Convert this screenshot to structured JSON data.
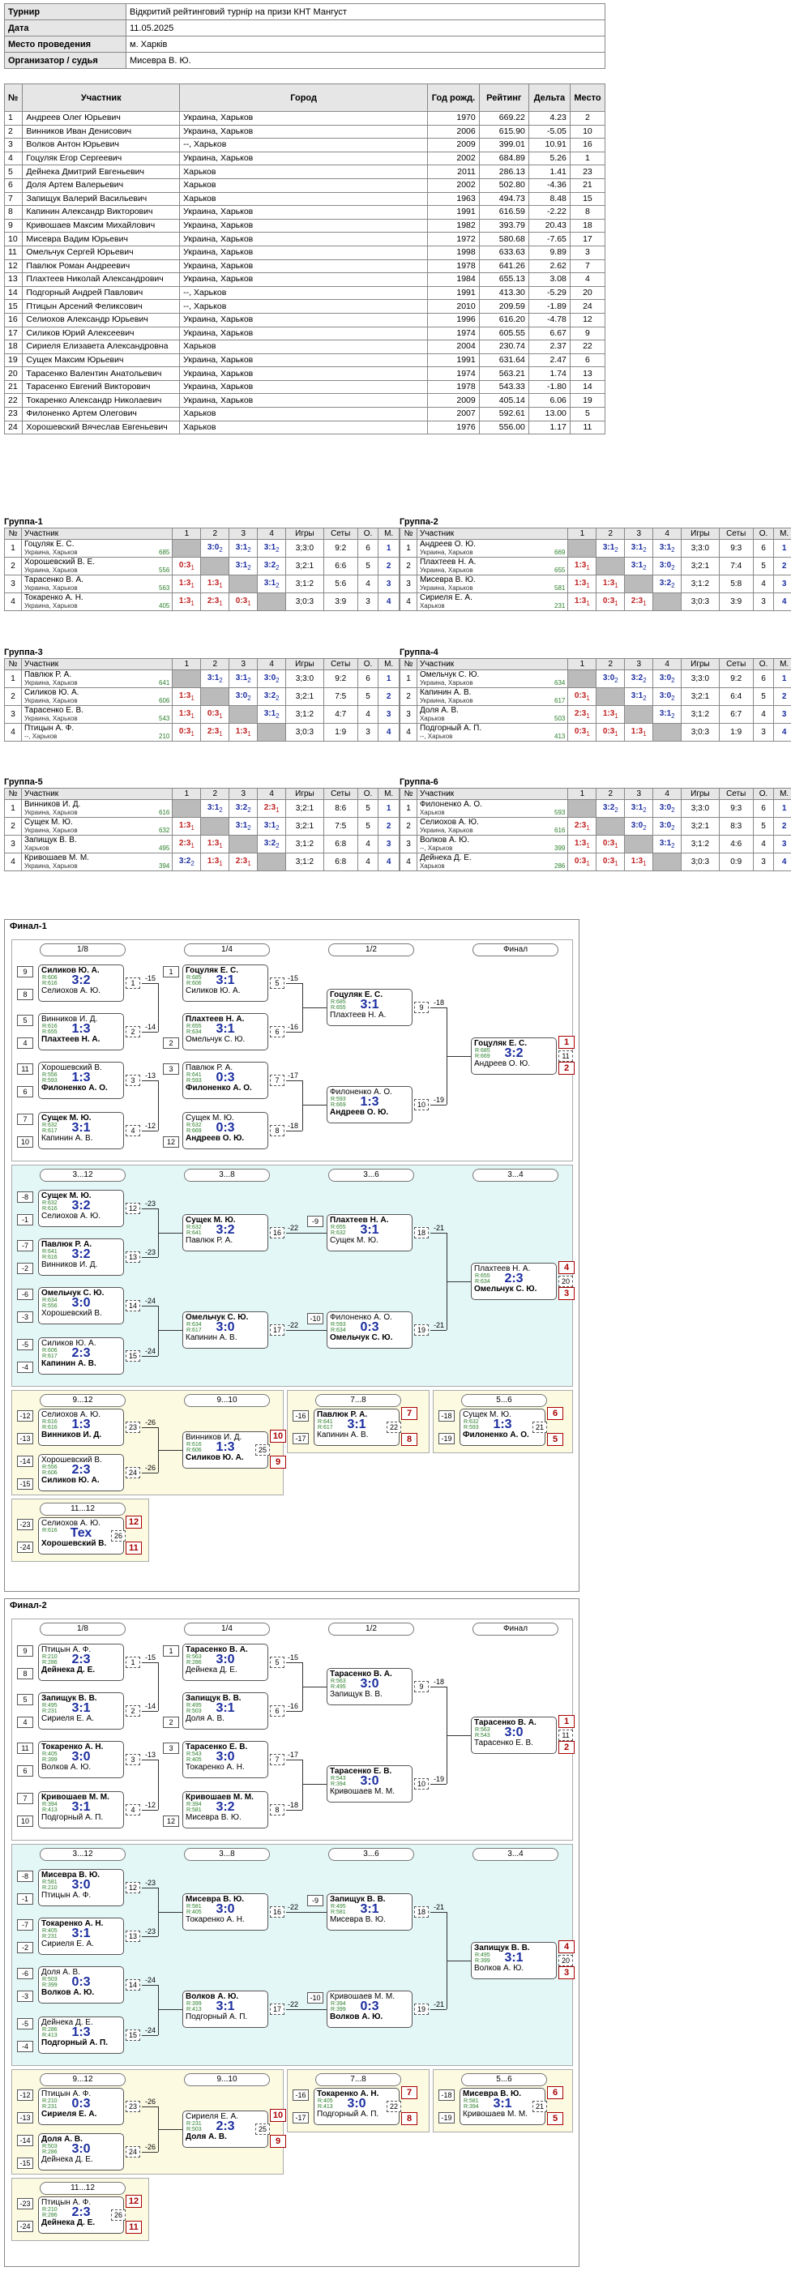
{
  "info": [
    {
      "k": "Турнир",
      "v": "Відкритий рейтинговий турнір на призи КНТ Мангуст"
    },
    {
      "k": "Дата",
      "v": "11.05.2025"
    },
    {
      "k": "Место проведения",
      "v": "м. Харків"
    },
    {
      "k": "Организатор / судья",
      "v": "Мисевра В. Ю."
    }
  ],
  "players_header": [
    "№",
    "Участник",
    "Город",
    "Год рожд.",
    "Рейтинг",
    "Дельта",
    "Место"
  ],
  "players": [
    [
      "1",
      "Андреев Олег Юрьевич",
      "Украина, Харьков",
      "1970",
      "669.22",
      "4.23",
      "2"
    ],
    [
      "2",
      "Винников Иван Денисович",
      "Украина, Харьков",
      "2006",
      "615.90",
      "-5.05",
      "10"
    ],
    [
      "3",
      "Волков Антон Юрьевич",
      "--, Харьков",
      "2009",
      "399.01",
      "10.91",
      "16"
    ],
    [
      "4",
      "Гоцуляк Егор Сергеевич",
      "Украина, Харьков",
      "2002",
      "684.89",
      "5.26",
      "1"
    ],
    [
      "5",
      "Дейнека Дмитрий Евгеньевич",
      "Харьков",
      "2011",
      "286.13",
      "1.41",
      "23"
    ],
    [
      "6",
      "Доля Артем Валерьевич",
      "Харьков",
      "2002",
      "502.80",
      "-4.36",
      "21"
    ],
    [
      "7",
      "Запищук Валерий Васильевич",
      "Харьков",
      "1963",
      "494.73",
      "8.48",
      "15"
    ],
    [
      "8",
      "Капинин Александр Викторович",
      "Украина, Харьков",
      "1991",
      "616.59",
      "-2.22",
      "8"
    ],
    [
      "9",
      "Кривошаев Максим Михайлович",
      "Украина, Харьков",
      "1982",
      "393.79",
      "20.43",
      "18"
    ],
    [
      "10",
      "Мисевра Вадим Юрьевич",
      "Украина, Харьков",
      "1972",
      "580.68",
      "-7.65",
      "17"
    ],
    [
      "11",
      "Омельчук Сергей Юрьевич",
      "Украина, Харьков",
      "1998",
      "633.63",
      "9.89",
      "3"
    ],
    [
      "12",
      "Павлюк Роман Андреевич",
      "Украина, Харьков",
      "1978",
      "641.26",
      "2.62",
      "7"
    ],
    [
      "13",
      "Плахтеев Николай Александрович",
      "Украина, Харьков",
      "1984",
      "655.13",
      "3.08",
      "4"
    ],
    [
      "14",
      "Подгорный Андрей Павлович",
      "--, Харьков",
      "1991",
      "413.30",
      "-5.29",
      "20"
    ],
    [
      "15",
      "Птицын Арсений Феликсович",
      "--, Харьков",
      "2010",
      "209.59",
      "-1.89",
      "24"
    ],
    [
      "16",
      "Селиохов Александр Юрьевич",
      "Украина, Харьков",
      "1996",
      "616.20",
      "-4.78",
      "12"
    ],
    [
      "17",
      "Силиков Юрий Алексеевич",
      "Украина, Харьков",
      "1974",
      "605.55",
      "6.67",
      "9"
    ],
    [
      "18",
      "Сириеля Елизавета Александровна",
      "Харьков",
      "2004",
      "230.74",
      "2.37",
      "22"
    ],
    [
      "19",
      "Сущек Максим Юрьевич",
      "Украина, Харьков",
      "1991",
      "631.64",
      "2.47",
      "6"
    ],
    [
      "20",
      "Тарасенко Валентин Анатольевич",
      "Украина, Харьков",
      "1974",
      "563.21",
      "1.74",
      "13"
    ],
    [
      "21",
      "Тарасенко Евгений Викторович",
      "Украина, Харьков",
      "1978",
      "543.33",
      "-1.80",
      "14"
    ],
    [
      "22",
      "Токаренко Александр Николаевич",
      "Украина, Харьков",
      "2009",
      "405.14",
      "6.06",
      "19"
    ],
    [
      "23",
      "Филоненко Артем Олегович",
      "Харьков",
      "2007",
      "592.61",
      "13.00",
      "5"
    ],
    [
      "24",
      "Хорошевский Вячеслав Евгеньевич",
      "Харьков",
      "1976",
      "556.00",
      "1.17",
      "11"
    ]
  ],
  "group_header": [
    "№",
    "Участник",
    "1",
    "2",
    "3",
    "4",
    "Игры",
    "Сеты",
    "О.",
    "М."
  ],
  "groups": [
    {
      "title": "Группа-1",
      "rows": [
        {
          "n": "1",
          "name": "Гоцуляк Е. С.",
          "city": "Украина, Харьков",
          "rt": "685",
          "res": [
            "",
            "3:0",
            "3:1",
            "3:1"
          ],
          "subs": [
            "",
            "2",
            "2",
            "2"
          ],
          "games": "3;3:0",
          "sets": "9:2",
          "o": "6",
          "m": "1"
        },
        {
          "n": "2",
          "name": "Хорошевский В. Е.",
          "city": "Украина, Харьков",
          "rt": "556",
          "res": [
            "0:3",
            "",
            "3:1",
            "3:2"
          ],
          "subs": [
            "1",
            "",
            "2",
            "2"
          ],
          "games": "3;2:1",
          "sets": "6:6",
          "o": "5",
          "m": "2"
        },
        {
          "n": "3",
          "name": "Тарасенко В. А.",
          "city": "Украина, Харьков",
          "rt": "563",
          "res": [
            "1:3",
            "1:3",
            "",
            "3:1"
          ],
          "subs": [
            "1",
            "1",
            "",
            "2"
          ],
          "games": "3;1:2",
          "sets": "5:6",
          "o": "4",
          "m": "3"
        },
        {
          "n": "4",
          "name": "Токаренко А. Н.",
          "city": "Украина, Харьков",
          "rt": "405",
          "res": [
            "1:3",
            "2:3",
            "0:3",
            ""
          ],
          "subs": [
            "1",
            "1",
            "1",
            ""
          ],
          "games": "3;0:3",
          "sets": "3:9",
          "o": "3",
          "m": "4"
        }
      ]
    },
    {
      "title": "Группа-2",
      "rows": [
        {
          "n": "1",
          "name": "Андреев О. Ю.",
          "city": "Украина, Харьков",
          "rt": "669",
          "res": [
            "",
            "3:1",
            "3:1",
            "3:1"
          ],
          "subs": [
            "",
            "2",
            "2",
            "2"
          ],
          "games": "3;3:0",
          "sets": "9:3",
          "o": "6",
          "m": "1"
        },
        {
          "n": "2",
          "name": "Плахтеев Н. А.",
          "city": "Украина, Харьков",
          "rt": "655",
          "res": [
            "1:3",
            "",
            "3:1",
            "3:0"
          ],
          "subs": [
            "1",
            "",
            "2",
            "2"
          ],
          "games": "3;2:1",
          "sets": "7:4",
          "o": "5",
          "m": "2"
        },
        {
          "n": "3",
          "name": "Мисевра В. Ю.",
          "city": "Украина, Харьков",
          "rt": "581",
          "res": [
            "1:3",
            "1:3",
            "",
            "3:2"
          ],
          "subs": [
            "1",
            "1",
            "",
            "2"
          ],
          "games": "3;1:2",
          "sets": "5:8",
          "o": "4",
          "m": "3"
        },
        {
          "n": "4",
          "name": "Сириеля Е. А.",
          "city": "Харьков",
          "rt": "231",
          "res": [
            "1:3",
            "0:3",
            "2:3",
            ""
          ],
          "subs": [
            "1",
            "1",
            "1",
            ""
          ],
          "games": "3;0:3",
          "sets": "3:9",
          "o": "3",
          "m": "4"
        }
      ]
    },
    {
      "title": "Группа-3",
      "rows": [
        {
          "n": "1",
          "name": "Павлюк Р. А.",
          "city": "Украина, Харьков",
          "rt": "641",
          "res": [
            "",
            "3:1",
            "3:1",
            "3:0"
          ],
          "subs": [
            "",
            "2",
            "2",
            "2"
          ],
          "games": "3;3:0",
          "sets": "9:2",
          "o": "6",
          "m": "1"
        },
        {
          "n": "2",
          "name": "Силиков Ю. А.",
          "city": "Украина, Харьков",
          "rt": "606",
          "res": [
            "1:3",
            "",
            "3:0",
            "3:2"
          ],
          "subs": [
            "1",
            "",
            "2",
            "2"
          ],
          "games": "3;2:1",
          "sets": "7:5",
          "o": "5",
          "m": "2"
        },
        {
          "n": "3",
          "name": "Тарасенко Е. В.",
          "city": "Украина, Харьков",
          "rt": "543",
          "res": [
            "1:3",
            "0:3",
            "",
            "3:1"
          ],
          "subs": [
            "1",
            "1",
            "",
            "2"
          ],
          "games": "3;1:2",
          "sets": "4:7",
          "o": "4",
          "m": "3"
        },
        {
          "n": "4",
          "name": "Птицын А. Ф.",
          "city": "--, Харьков",
          "rt": "210",
          "res": [
            "0:3",
            "2:3",
            "1:3",
            ""
          ],
          "subs": [
            "1",
            "1",
            "1",
            ""
          ],
          "games": "3;0:3",
          "sets": "1:9",
          "o": "3",
          "m": "4"
        }
      ]
    },
    {
      "title": "Группа-4",
      "rows": [
        {
          "n": "1",
          "name": "Омельчук С. Ю.",
          "city": "Украина, Харьков",
          "rt": "634",
          "res": [
            "",
            "3:0",
            "3:2",
            "3:0"
          ],
          "subs": [
            "",
            "2",
            "2",
            "2"
          ],
          "games": "3;3:0",
          "sets": "9:2",
          "o": "6",
          "m": "1"
        },
        {
          "n": "2",
          "name": "Капинин А. В.",
          "city": "Украина, Харьков",
          "rt": "617",
          "res": [
            "0:3",
            "",
            "3:1",
            "3:0"
          ],
          "subs": [
            "1",
            "",
            "2",
            "2"
          ],
          "games": "3;2:1",
          "sets": "6:4",
          "o": "5",
          "m": "2"
        },
        {
          "n": "3",
          "name": "Доля А. В.",
          "city": "Харьков",
          "rt": "503",
          "res": [
            "2:3",
            "1:3",
            "",
            "3:1"
          ],
          "subs": [
            "1",
            "1",
            "",
            "2"
          ],
          "games": "3;1:2",
          "sets": "6:7",
          "o": "4",
          "m": "3"
        },
        {
          "n": "4",
          "name": "Подгорный А. П.",
          "city": "--, Харьков",
          "rt": "413",
          "res": [
            "0:3",
            "0:3",
            "1:3",
            ""
          ],
          "subs": [
            "1",
            "1",
            "1",
            ""
          ],
          "games": "3;0:3",
          "sets": "1:9",
          "o": "3",
          "m": "4"
        }
      ]
    },
    {
      "title": "Группа-5",
      "rows": [
        {
          "n": "1",
          "name": "Винников И. Д.",
          "city": "Украина, Харьков",
          "rt": "616",
          "res": [
            "",
            "3:1",
            "3:2",
            "2:3"
          ],
          "subs": [
            "",
            "2",
            "2",
            "1"
          ],
          "games": "3;2:1",
          "sets": "8:6",
          "o": "5",
          "m": "1"
        },
        {
          "n": "2",
          "name": "Сущек М. Ю.",
          "city": "Украина, Харьков",
          "rt": "632",
          "res": [
            "1:3",
            "",
            "3:1",
            "3:1"
          ],
          "subs": [
            "1",
            "",
            "2",
            "2"
          ],
          "games": "3;2:1",
          "sets": "7:5",
          "o": "5",
          "m": "2"
        },
        {
          "n": "3",
          "name": "Запищук В. В.",
          "city": "Харьков",
          "rt": "495",
          "res": [
            "2:3",
            "1:3",
            "",
            "3:2"
          ],
          "subs": [
            "1",
            "1",
            "",
            "2"
          ],
          "games": "3;1:2",
          "sets": "6:8",
          "o": "4",
          "m": "3"
        },
        {
          "n": "4",
          "name": "Кривошаев М. М.",
          "city": "Украина, Харьков",
          "rt": "394",
          "res": [
            "3:2",
            "1:3",
            "2:3",
            ""
          ],
          "subs": [
            "2",
            "1",
            "1",
            ""
          ],
          "games": "3;1:2",
          "sets": "6:8",
          "o": "4",
          "m": "4"
        }
      ]
    },
    {
      "title": "Группа-6",
      "rows": [
        {
          "n": "1",
          "name": "Филоненко А. О.",
          "city": "Харьков",
          "rt": "593",
          "res": [
            "",
            "3:2",
            "3:1",
            "3:0"
          ],
          "subs": [
            "",
            "2",
            "2",
            "2"
          ],
          "games": "3;3:0",
          "sets": "9:3",
          "o": "6",
          "m": "1"
        },
        {
          "n": "2",
          "name": "Селиохов А. Ю.",
          "city": "Украина, Харьков",
          "rt": "616",
          "res": [
            "2:3",
            "",
            "3:0",
            "3:0"
          ],
          "subs": [
            "1",
            "",
            "2",
            "2"
          ],
          "games": "3;2:1",
          "sets": "8:3",
          "o": "5",
          "m": "2"
        },
        {
          "n": "3",
          "name": "Волков А. Ю.",
          "city": "--, Харьков",
          "rt": "399",
          "res": [
            "1:3",
            "0:3",
            "",
            "3:1"
          ],
          "subs": [
            "1",
            "1",
            "",
            "2"
          ],
          "games": "3;1:2",
          "sets": "4:6",
          "o": "4",
          "m": "3"
        },
        {
          "n": "4",
          "name": "Дейнека Д. Е.",
          "city": "Харьков",
          "rt": "286",
          "res": [
            "0:3",
            "0:3",
            "1:3",
            ""
          ],
          "subs": [
            "1",
            "1",
            "1",
            ""
          ],
          "games": "3;0:3",
          "sets": "0:9",
          "o": "3",
          "m": "4"
        }
      ]
    }
  ],
  "finals": [
    {
      "title": "Финал-1",
      "rounds_main": [
        "1/8",
        "1/4",
        "1/2",
        "Финал"
      ],
      "rounds_cons": [
        "3...12",
        "3...8",
        "3...6",
        "3...4"
      ],
      "rounds_low": [
        "9...12",
        "9...10",
        "7...8",
        "5...6",
        "11...12"
      ],
      "matches": [
        {
          "id": "a1",
          "w": "Силиков Ю. А.",
          "r1": "R:606",
          "r2": "R:616",
          "sc": "3:2",
          "l": "Селиохов А. Ю.",
          "n": "1"
        },
        {
          "id": "a2",
          "w": "Плахтеев Н. А.",
          "r1": "R:616",
          "r2": "R:655",
          "sc": "1:3",
          "l": "Винников И. Д.",
          "n": "2",
          "top": "Винников И. Д.",
          "bot": "Плахтеев Н. А."
        },
        {
          "id": "a3",
          "w": "Филоненко А. О.",
          "r1": "R:556",
          "r2": "R:593",
          "sc": "1:3",
          "l": "Хорошевский В. Е.",
          "n": "3",
          "top": "Хорошевский В. Е.",
          "bot": "Филоненко А. О."
        },
        {
          "id": "a4",
          "w": "Сущек М. Ю.",
          "r1": "R:632",
          "r2": "R:617",
          "sc": "3:1",
          "l": "Капинин А. В.",
          "n": "4"
        },
        {
          "id": "b1",
          "w": "Гоцуляк Е. С.",
          "r1": "R:685",
          "r2": "R:606",
          "sc": "3:1",
          "l": "Силиков Ю. А.",
          "n": "5"
        },
        {
          "id": "b2",
          "w": "Плахтеев Н. А.",
          "r1": "R:655",
          "r2": "R:634",
          "sc": "3:1",
          "l": "Омельчук С. Ю.",
          "n": "6"
        },
        {
          "id": "b3",
          "w": "Филоненко А. О.",
          "r1": "R:641",
          "r2": "R:593",
          "sc": "0:3",
          "l": "Павлюк Р. А.",
          "n": "7",
          "top": "Павлюк Р. А.",
          "bot": "Филоненко А. О."
        },
        {
          "id": "b4",
          "w": "Андреев О. Ю.",
          "r1": "R:632",
          "r2": "R:669",
          "sc": "0:3",
          "l": "Сущек М. Ю.",
          "n": "8",
          "top": "Сущек М. Ю.",
          "bot": "Андреев О. Ю."
        },
        {
          "id": "c1",
          "w": "Гоцуляк Е. С.",
          "r1": "R:685",
          "r2": "R:655",
          "sc": "3:1",
          "l": "Плахтеев Н. А.",
          "n": "9"
        },
        {
          "id": "c2",
          "w": "Андреев О. Ю.",
          "r1": "R:593",
          "r2": "R:669",
          "sc": "1:3",
          "l": "Филоненко А. О.",
          "n": "10",
          "top": "Филоненко А. О.",
          "bot": "Андреев О. Ю."
        },
        {
          "id": "d1",
          "w": "Гоцуляк Е. С.",
          "r1": "R:685",
          "r2": "R:669",
          "sc": "3:2",
          "l": "Андреев О. Ю.",
          "n": "11"
        }
      ]
    }
  ],
  "f1_places": {
    "p1": "1",
    "p2": "2",
    "p3": "3",
    "p4": "4",
    "p5": "5",
    "p6": "6",
    "p7": "7",
    "p8": "8",
    "p9": "9",
    "p10": "10",
    "p11": "11",
    "p12": "12"
  }
}
